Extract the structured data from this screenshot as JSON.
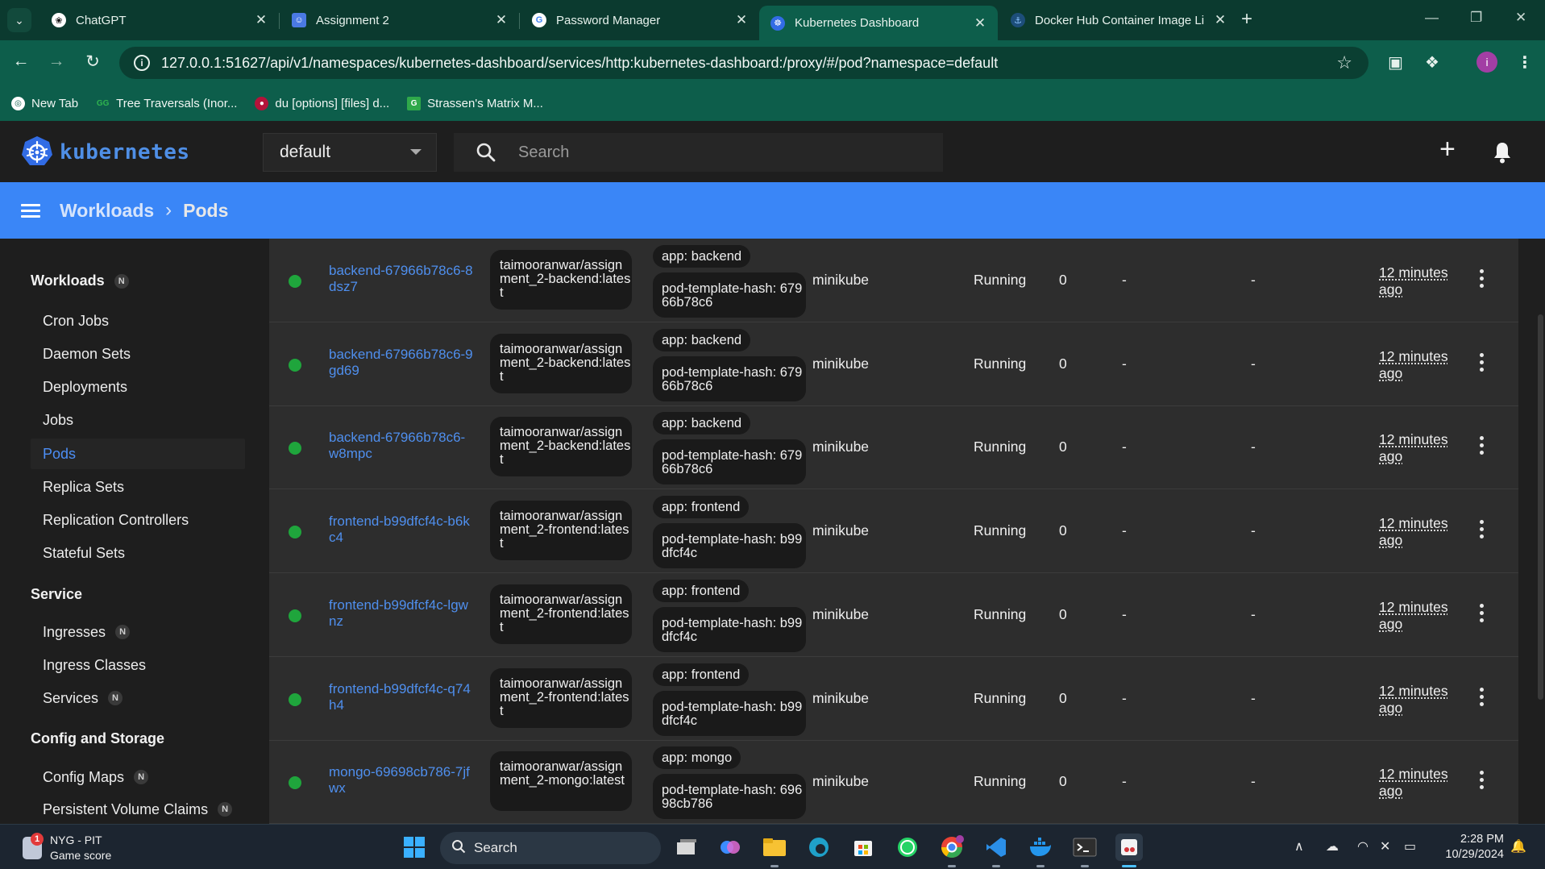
{
  "browser": {
    "tabs": [
      {
        "title": "ChatGPT",
        "icon": "chatgpt-icon",
        "active": false
      },
      {
        "title": "Assignment 2",
        "icon": "classroom-icon",
        "active": false
      },
      {
        "title": "Password Manager",
        "icon": "google-icon",
        "active": false
      },
      {
        "title": "Kubernetes Dashboard",
        "icon": "kubernetes-icon",
        "active": true
      },
      {
        "title": "Docker Hub Container Image Li",
        "icon": "docker-icon",
        "active": false
      }
    ],
    "url": "127.0.0.1:51627/api/v1/namespaces/kubernetes-dashboard/services/http:kubernetes-dashboard:/proxy/#/pod?namespace=default",
    "profile_initial": "i",
    "bookmarks": [
      "New Tab",
      "Tree Traversals (Inor...",
      "du [options] [files] d...",
      "Strassen's Matrix M..."
    ]
  },
  "header": {
    "brand": "kubernetes",
    "namespace": "default",
    "search_placeholder": "Search"
  },
  "breadcrumb": {
    "parent": "Workloads",
    "current": "Pods"
  },
  "sidebar": {
    "sections": [
      {
        "title": "Workloads",
        "badge": "N",
        "items": [
          "Cron Jobs",
          "Daemon Sets",
          "Deployments",
          "Jobs",
          "Pods",
          "Replica Sets",
          "Replication Controllers",
          "Stateful Sets"
        ]
      },
      {
        "title": "Service",
        "items": [
          "Ingresses",
          "Ingress Classes",
          "Services"
        ],
        "badges": {
          "Ingresses": "N",
          "Services": "N"
        }
      },
      {
        "title": "Config and Storage",
        "items": [
          "Config Maps",
          "Persistent Volume Claims"
        ],
        "badges": {
          "Config Maps": "N",
          "Persistent Volume Claims": "N"
        }
      }
    ],
    "active_item": "Pods"
  },
  "pods": [
    {
      "name": "backend-67966b78c6-8dsz7",
      "image": "taimooranwar/assignment_2-backend:latest",
      "label_app": "app: backend",
      "label_hash": "pod-template-hash: 67966b78c6",
      "node": "minikube",
      "status": "Running",
      "restarts": "0",
      "cpu": "-",
      "memory": "-",
      "age": "12 minutes ago"
    },
    {
      "name": "backend-67966b78c6-9gd69",
      "image": "taimooranwar/assignment_2-backend:latest",
      "label_app": "app: backend",
      "label_hash": "pod-template-hash: 67966b78c6",
      "node": "minikube",
      "status": "Running",
      "restarts": "0",
      "cpu": "-",
      "memory": "-",
      "age": "12 minutes ago"
    },
    {
      "name": "backend-67966b78c6-w8mpc",
      "image": "taimooranwar/assignment_2-backend:latest",
      "label_app": "app: backend",
      "label_hash": "pod-template-hash: 67966b78c6",
      "node": "minikube",
      "status": "Running",
      "restarts": "0",
      "cpu": "-",
      "memory": "-",
      "age": "12 minutes ago"
    },
    {
      "name": "frontend-b99dfcf4c-b6kc4",
      "image": "taimooranwar/assignment_2-frontend:latest",
      "label_app": "app: frontend",
      "label_hash": "pod-template-hash: b99dfcf4c",
      "node": "minikube",
      "status": "Running",
      "restarts": "0",
      "cpu": "-",
      "memory": "-",
      "age": "12 minutes ago"
    },
    {
      "name": "frontend-b99dfcf4c-lgwnz",
      "image": "taimooranwar/assignment_2-frontend:latest",
      "label_app": "app: frontend",
      "label_hash": "pod-template-hash: b99dfcf4c",
      "node": "minikube",
      "status": "Running",
      "restarts": "0",
      "cpu": "-",
      "memory": "-",
      "age": "12 minutes ago"
    },
    {
      "name": "frontend-b99dfcf4c-q74h4",
      "image": "taimooranwar/assignment_2-frontend:latest",
      "label_app": "app: frontend",
      "label_hash": "pod-template-hash: b99dfcf4c",
      "node": "minikube",
      "status": "Running",
      "restarts": "0",
      "cpu": "-",
      "memory": "-",
      "age": "12 minutes ago"
    },
    {
      "name": "mongo-69698cb786-7jfwx",
      "image": "taimooranwar/assignment_2-mongo:latest",
      "label_app": "app: mongo",
      "label_hash": "pod-template-hash: 69698cb786",
      "node": "minikube",
      "status": "Running",
      "restarts": "0",
      "cpu": "-",
      "memory": "-",
      "age": "12 minutes ago"
    }
  ],
  "taskbar": {
    "widget_title": "NYG - PIT",
    "widget_subtitle": "Game score",
    "widget_badge": "1",
    "search_label": "Search",
    "time": "2:28 PM",
    "date": "10/29/2024"
  },
  "colors": {
    "accent_blue": "#3a86f7",
    "running_green": "#1fa53c",
    "link_blue": "#4f8fee",
    "chrome_green": "#0d5e4b"
  }
}
